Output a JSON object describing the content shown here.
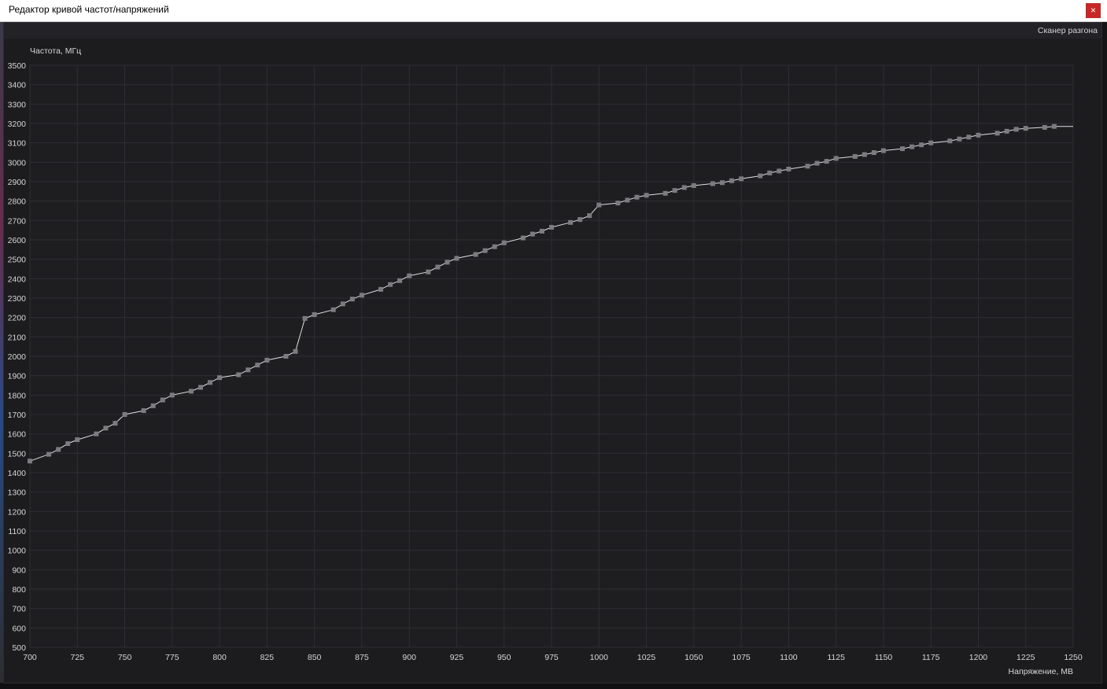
{
  "window": {
    "title": "Редактор кривой частот/напряжений",
    "close_glyph": "×",
    "close_icon": "close-icon"
  },
  "toolbar": {
    "scanner_label": "Сканер разгона"
  },
  "colors": {
    "background": "#1c1c1f",
    "grid": "#2e2e33",
    "line": "#e0e0e0",
    "point": "#7c7c80",
    "close_button": "#c62828"
  },
  "chart_data": {
    "type": "line",
    "xlabel": "Напряжение, МВ",
    "ylabel": "Частота, МГц",
    "xlim": [
      700,
      1250
    ],
    "ylim": [
      500,
      3500
    ],
    "x_ticks": [
      "700",
      "725",
      "750",
      "775",
      "800",
      "825",
      "850",
      "875",
      "900",
      "925",
      "950",
      "975",
      "1000",
      "1025",
      "1050",
      "1075",
      "1100",
      "1125",
      "1150",
      "1175",
      "1200",
      "1225",
      "1250"
    ],
    "y_ticks": [
      "3500",
      "3400",
      "3300",
      "3200",
      "3100",
      "3000",
      "2900",
      "2800",
      "2700",
      "2600",
      "2500",
      "2400",
      "2300",
      "2200",
      "2100",
      "2000",
      "1900",
      "1800",
      "1700",
      "1600",
      "1500",
      "1400",
      "1300",
      "1200",
      "1100",
      "1000",
      "900",
      "800",
      "700",
      "600",
      "500"
    ],
    "grid": true,
    "series": [
      {
        "x": [
          700,
          710,
          715,
          720,
          725,
          735,
          740,
          745,
          750,
          760,
          765,
          770,
          775,
          785,
          790,
          795,
          800,
          810,
          815,
          820,
          825,
          835,
          840,
          845,
          850,
          860,
          865,
          870,
          875,
          885,
          890,
          895,
          900,
          910,
          915,
          920,
          925,
          935,
          940,
          945,
          950,
          960,
          965,
          970,
          975,
          985,
          990,
          995,
          1000,
          1010,
          1015,
          1020,
          1025,
          1035,
          1040,
          1045,
          1050,
          1060,
          1065,
          1070,
          1075,
          1085,
          1090,
          1095,
          1100,
          1110,
          1115,
          1120,
          1125,
          1135,
          1140,
          1145,
          1150,
          1160,
          1165,
          1170,
          1175,
          1185,
          1190,
          1195,
          1200,
          1210,
          1215,
          1220,
          1225,
          1235,
          1240,
          1250
        ],
        "y": [
          1460,
          1495,
          1520,
          1550,
          1570,
          1600,
          1630,
          1655,
          1700,
          1720,
          1745,
          1775,
          1800,
          1820,
          1840,
          1865,
          1890,
          1905,
          1930,
          1955,
          1980,
          2000,
          2025,
          2195,
          2215,
          2240,
          2270,
          2295,
          2315,
          2345,
          2370,
          2390,
          2415,
          2435,
          2460,
          2485,
          2505,
          2525,
          2545,
          2565,
          2585,
          2610,
          2630,
          2645,
          2665,
          2690,
          2705,
          2725,
          2780,
          2790,
          2805,
          2820,
          2830,
          2840,
          2855,
          2870,
          2880,
          2890,
          2895,
          2905,
          2915,
          2930,
          2945,
          2955,
          2965,
          2980,
          2995,
          3005,
          3020,
          3030,
          3040,
          3050,
          3060,
          3070,
          3080,
          3090,
          3100,
          3110,
          3120,
          3130,
          3140,
          3150,
          3160,
          3170,
          3175,
          3180,
          3185,
          3185
        ],
        "point_x": [
          700,
          710,
          715,
          720,
          725,
          735,
          740,
          745,
          750,
          760,
          765,
          770,
          775,
          785,
          790,
          795,
          800,
          810,
          815,
          820,
          825,
          835,
          840,
          845,
          850,
          860,
          865,
          870,
          875,
          885,
          890,
          895,
          900,
          910,
          915,
          920,
          925,
          935,
          940,
          945,
          950,
          960,
          965,
          970,
          975,
          985,
          990,
          995,
          1000,
          1010,
          1015,
          1020,
          1025,
          1035,
          1040,
          1045,
          1050,
          1060,
          1065,
          1070,
          1075,
          1085,
          1090,
          1095,
          1100,
          1110,
          1115,
          1120,
          1125,
          1135,
          1140,
          1145,
          1150,
          1160,
          1165,
          1170,
          1175,
          1185,
          1190,
          1195,
          1200,
          1210,
          1215,
          1220,
          1225,
          1235,
          1240
        ]
      }
    ]
  }
}
